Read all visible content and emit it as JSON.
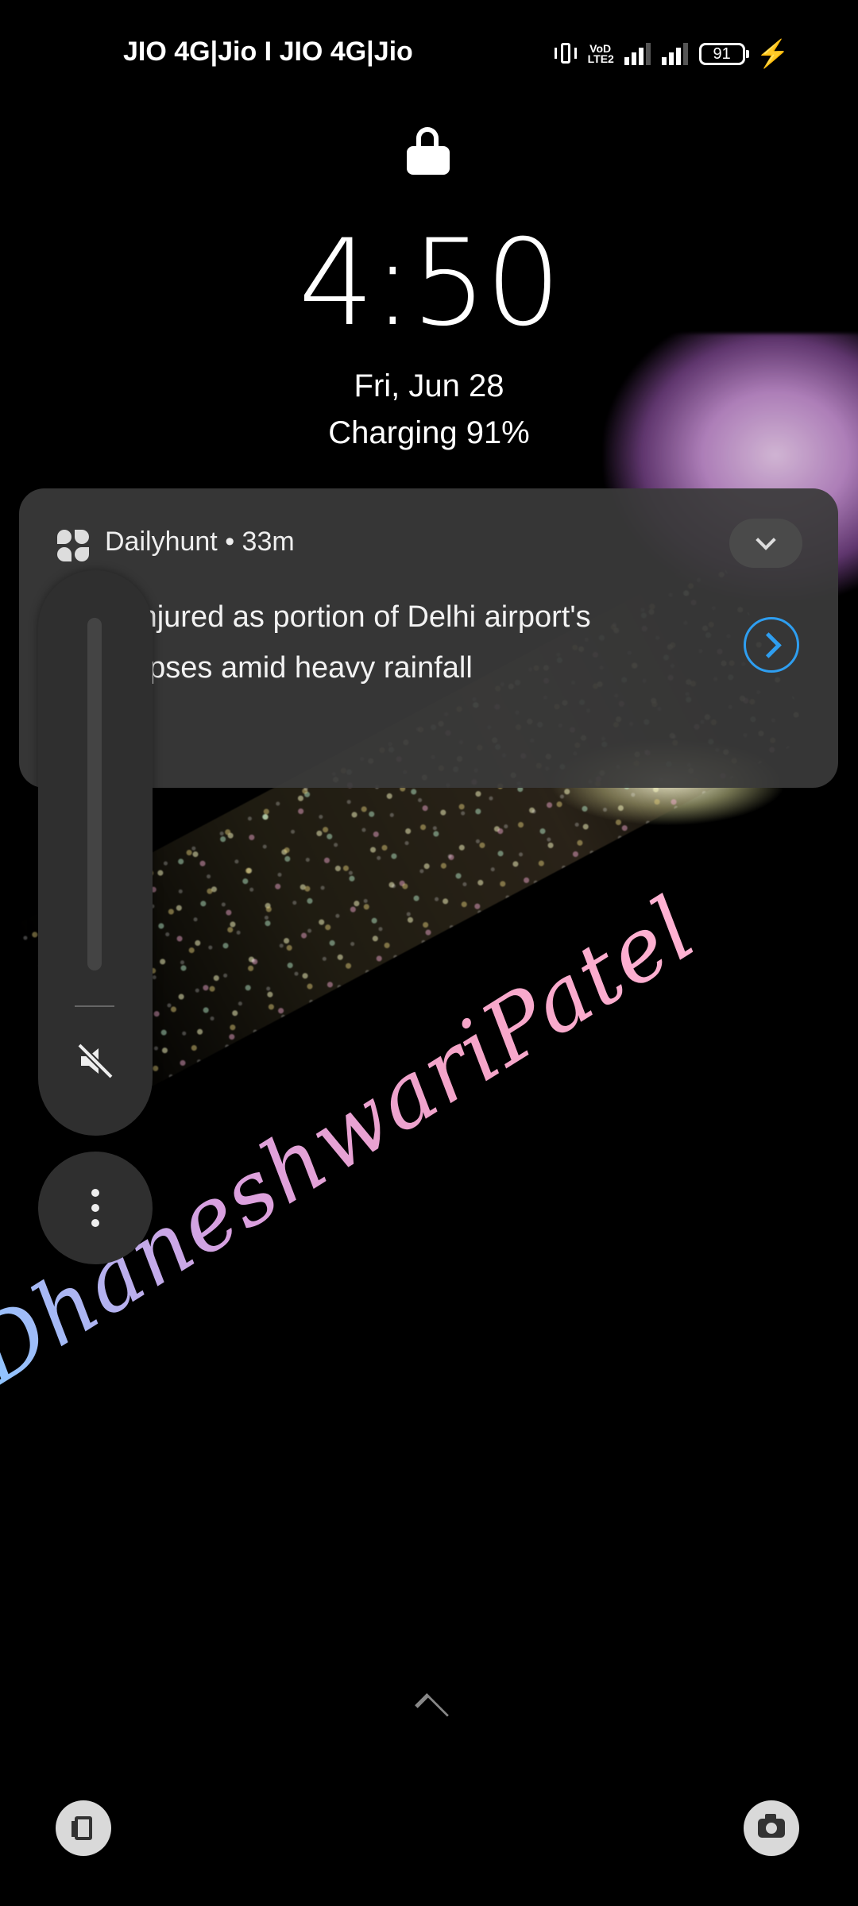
{
  "status_bar": {
    "carrier_text": "JIO 4G|Jio I JIO 4G|Jio",
    "volte_label": "VoD LTE2",
    "battery_level": "91",
    "icons": [
      "vibrate-icon",
      "volte-icon",
      "signal-icon",
      "signal-icon",
      "battery-icon",
      "charging-bolt-icon"
    ],
    "bolt_color": "#f3a63a"
  },
  "lockscreen": {
    "lock_icon": "unlocked-padlock-icon",
    "time": "4:50",
    "date": "Fri, Jun 28",
    "charging_status": "Charging 91%"
  },
  "notification": {
    "app_name": "Dailyhunt",
    "separator": "•",
    "age": "33m",
    "header_text": "Dailyhunt • 33m",
    "body_line1": "al injured as portion of Delhi airport's",
    "body_line2": "ollapses amid heavy rainfall",
    "expand_icon": "chevron-down-icon",
    "action_icon": "chevron-right-circle-icon",
    "accent_color": "#2e9ef0"
  },
  "volume_panel": {
    "level": 0,
    "mute_icon": "volume-mute-icon",
    "more_icon": "more-vertical-icon"
  },
  "wallpaper": {
    "signature_text": "DhaneshwariPatel"
  },
  "bottom": {
    "swipe_icon": "chevron-up-icon",
    "left_shortcut_icon": "phone-icon",
    "right_shortcut_icon": "camera-icon"
  }
}
